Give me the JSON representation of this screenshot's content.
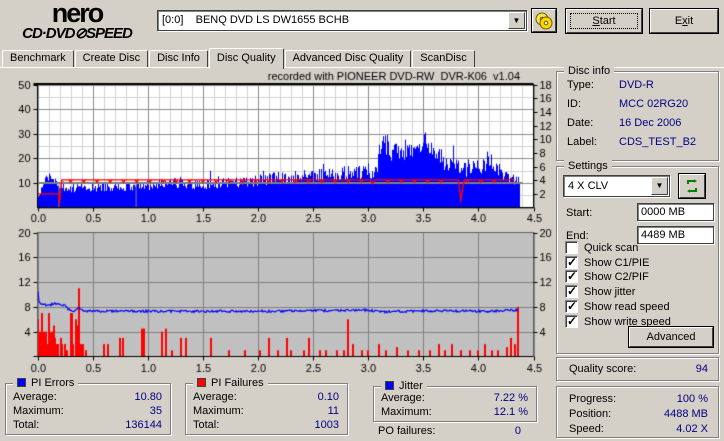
{
  "window": {
    "logo_line1": "nero",
    "logo_line2": "CD·DVD⊘SPEED",
    "drive": "[0:0]    BENQ DVD LS DW1655 BCHB",
    "start_label": "Start",
    "exit_label": "Exit"
  },
  "tabs": [
    {
      "label": "Benchmark",
      "active": false
    },
    {
      "label": "Create Disc",
      "active": false
    },
    {
      "label": "Disc Info",
      "active": false
    },
    {
      "label": "Disc Quality",
      "active": true
    },
    {
      "label": "Advanced Disc Quality",
      "active": false
    },
    {
      "label": "ScanDisc",
      "active": false
    }
  ],
  "disc_info": {
    "title": "Disc info",
    "rows": [
      {
        "label": "Type:",
        "value": "DVD-R"
      },
      {
        "label": "ID:",
        "value": "MCC 02RG20"
      },
      {
        "label": "Date:",
        "value": "16 Dec 2006"
      },
      {
        "label": "Label:",
        "value": "CDS_TEST_B2"
      }
    ]
  },
  "settings": {
    "title": "Settings",
    "speed_selected": "4 X CLV",
    "start_label": "Start:",
    "start_value": "0000 MB",
    "end_label": "End:",
    "end_value": "4489 MB",
    "checkboxes": [
      {
        "label": "Quick scan",
        "checked": false
      },
      {
        "label": "Show C1/PIE",
        "checked": true
      },
      {
        "label": "Show C2/PIF",
        "checked": true
      },
      {
        "label": "Show jitter",
        "checked": true
      },
      {
        "label": "Show read speed",
        "checked": true
      },
      {
        "label": "Show write speed",
        "checked": true
      }
    ],
    "advanced_label": "Advanced"
  },
  "quality": {
    "label": "Quality score:",
    "value": "94"
  },
  "progress_panel": {
    "rows": [
      {
        "label": "Progress:",
        "value": "100 %"
      },
      {
        "label": "Position:",
        "value": "4488 MB"
      },
      {
        "label": "Speed:",
        "value": "4.02 X"
      }
    ]
  },
  "stats": {
    "pi_errors": {
      "title": "PI Errors",
      "color": "#0000ff",
      "rows": [
        {
          "label": "Average:",
          "value": "10.80"
        },
        {
          "label": "Maximum:",
          "value": "35"
        },
        {
          "label": "Total:",
          "value": "136144"
        }
      ]
    },
    "pi_failures": {
      "title": "PI Failures",
      "color": "#ff0000",
      "rows": [
        {
          "label": "Average:",
          "value": "0.10"
        },
        {
          "label": "Maximum:",
          "value": "11"
        },
        {
          "label": "Total:",
          "value": "1003"
        }
      ]
    },
    "jitter": {
      "title": "Jitter",
      "color": "#0000ff",
      "rows": [
        {
          "label": "Average:",
          "value": "7.22 %"
        },
        {
          "label": "Maximum:",
          "value": "12.1 %"
        }
      ]
    },
    "po_failures": {
      "label": "PO failures:",
      "value": "0"
    }
  },
  "chart_data": [
    {
      "type": "area",
      "title": "recorded with PIONEER DVD-RW  DVR-K06  v1.04",
      "bg": "#ffffff",
      "x_range": [
        0,
        4.5
      ],
      "x_tick_step": 0.5,
      "left_axis": {
        "range": [
          0,
          50
        ],
        "tick_step": 10
      },
      "right_axis": {
        "range": [
          0,
          18
        ],
        "tick_step": 2
      },
      "grid": {
        "minor_x": 0.1,
        "minor_y": 5,
        "major_x": 0.5,
        "major_y": 10
      },
      "pi_errors": {
        "name": "PI errors",
        "color": "#0000ff",
        "axis": "left",
        "end_x": 4.37,
        "seed": 7,
        "profile": [
          [
            0,
            5
          ],
          [
            0.03,
            7
          ],
          [
            0.08,
            12
          ],
          [
            0.12,
            13
          ],
          [
            0.15,
            11
          ],
          [
            0.18,
            9
          ],
          [
            0.22,
            8
          ],
          [
            0.3,
            7.5
          ],
          [
            0.5,
            8
          ],
          [
            0.7,
            8.5
          ],
          [
            0.9,
            8.5
          ],
          [
            1.0,
            9
          ],
          [
            1.2,
            10
          ],
          [
            1.4,
            9
          ],
          [
            1.6,
            10
          ],
          [
            1.8,
            10
          ],
          [
            2.0,
            11
          ],
          [
            2.2,
            12
          ],
          [
            2.4,
            12.5
          ],
          [
            2.6,
            13
          ],
          [
            2.8,
            14
          ],
          [
            3.0,
            14
          ],
          [
            3.05,
            15
          ],
          [
            3.08,
            18
          ],
          [
            3.1,
            26
          ],
          [
            3.15,
            27
          ],
          [
            3.2,
            24
          ],
          [
            3.3,
            23
          ],
          [
            3.4,
            23
          ],
          [
            3.5,
            26
          ],
          [
            3.55,
            27
          ],
          [
            3.6,
            22
          ],
          [
            3.7,
            18
          ],
          [
            3.8,
            16
          ],
          [
            3.9,
            16
          ],
          [
            4.0,
            17
          ],
          [
            4.1,
            18
          ],
          [
            4.15,
            16
          ],
          [
            4.2,
            15
          ],
          [
            4.3,
            12
          ],
          [
            4.33,
            11
          ],
          [
            4.37,
            9
          ]
        ],
        "noise_profile": [
          [
            0,
            1.5
          ],
          [
            1.0,
            2
          ],
          [
            2.0,
            2.5
          ],
          [
            3.0,
            3
          ],
          [
            3.08,
            4
          ],
          [
            3.1,
            5
          ],
          [
            3.6,
            5
          ],
          [
            3.65,
            3.5
          ],
          [
            4.2,
            3.5
          ],
          [
            4.37,
            2
          ]
        ],
        "spike_chance": 0.1,
        "max": 35.5
      },
      "read_speed": {
        "name": "read speed",
        "color": "#808080",
        "axis": "right",
        "value": 3.6,
        "x_from": 0,
        "x_to": 4.4,
        "drops": [
          0.19,
          0.89
        ]
      },
      "write_speed": {
        "name": "write speed",
        "color": "#ff0000",
        "axis": "right",
        "points": [
          [
            0,
            2
          ],
          [
            0.19,
            2
          ],
          [
            0.2,
            0.7
          ],
          [
            0.22,
            4.05
          ],
          [
            3.02,
            4.05
          ],
          [
            3.04,
            3.5
          ],
          [
            3.06,
            4.05
          ],
          [
            3.82,
            4.05
          ],
          [
            3.84,
            1.1
          ],
          [
            3.87,
            4.05
          ],
          [
            4.33,
            4.05
          ]
        ],
        "sawtooth": {
          "from": 0.3,
          "to": 4.25,
          "interval": 0.12,
          "depth": 0.35,
          "base": 4.05
        }
      }
    },
    {
      "type": "bars+line",
      "bg": "#c0c0c0",
      "x_range": [
        0,
        4.5
      ],
      "x_tick_step": 0.5,
      "left_axis": {
        "range": [
          0,
          20
        ],
        "tick_step": 4
      },
      "right_axis": {
        "range": [
          0,
          20
        ],
        "tick_step": 4
      },
      "grid": {
        "major_x": 0.5,
        "major_y": 4
      },
      "pi_failures": {
        "name": "PI failures",
        "color": "#ff0000",
        "bars": [
          [
            0.005,
            6
          ],
          [
            0.015,
            4
          ],
          [
            0.025,
            3
          ],
          [
            0.03,
            4
          ],
          [
            0.045,
            7
          ],
          [
            0.055,
            4
          ],
          [
            0.065,
            3
          ],
          [
            0.075,
            4
          ],
          [
            0.09,
            2
          ],
          [
            0.1,
            7
          ],
          [
            0.11,
            4
          ],
          [
            0.12,
            3
          ],
          [
            0.135,
            4
          ],
          [
            0.15,
            5
          ],
          [
            0.16,
            3
          ],
          [
            0.175,
            2
          ],
          [
            0.19,
            2
          ],
          [
            0.21,
            3
          ],
          [
            0.225,
            2
          ],
          [
            0.25,
            2
          ],
          [
            0.27,
            1
          ],
          [
            0.3,
            7
          ],
          [
            0.31,
            7
          ],
          [
            0.325,
            2
          ],
          [
            0.35,
            6
          ],
          [
            0.36,
            5
          ],
          [
            0.38,
            11
          ],
          [
            0.395,
            2
          ],
          [
            0.41,
            2
          ],
          [
            0.44,
            1
          ],
          [
            0.6,
            2
          ],
          [
            0.64,
            2
          ],
          [
            0.75,
            3
          ],
          [
            0.78,
            3
          ],
          [
            0.95,
            4.5
          ],
          [
            0.97,
            4.5
          ],
          [
            1.13,
            4
          ],
          [
            1.17,
            4.5
          ],
          [
            1.22,
            1
          ],
          [
            1.3,
            3
          ],
          [
            1.35,
            3
          ],
          [
            1.57,
            3
          ],
          [
            1.74,
            1
          ],
          [
            1.88,
            1
          ],
          [
            2.02,
            1
          ],
          [
            2.1,
            3
          ],
          [
            2.18,
            1
          ],
          [
            2.26,
            3
          ],
          [
            2.3,
            1
          ],
          [
            2.42,
            1
          ],
          [
            2.46,
            3
          ],
          [
            2.56,
            1
          ],
          [
            2.62,
            1
          ],
          [
            2.72,
            1
          ],
          [
            2.78,
            1
          ],
          [
            2.82,
            6
          ],
          [
            2.86,
            2
          ],
          [
            2.94,
            1
          ],
          [
            3.0,
            1
          ],
          [
            3.1,
            2
          ],
          [
            3.16,
            1
          ],
          [
            3.26,
            1.5
          ],
          [
            3.36,
            1
          ],
          [
            3.46,
            1
          ],
          [
            3.56,
            1
          ],
          [
            3.64,
            2
          ],
          [
            3.7,
            1
          ],
          [
            3.76,
            2
          ],
          [
            3.84,
            1
          ],
          [
            3.92,
            1
          ],
          [
            4.0,
            1
          ],
          [
            4.06,
            2
          ],
          [
            4.12,
            1
          ],
          [
            4.18,
            1
          ],
          [
            4.26,
            1.5
          ],
          [
            4.3,
            3
          ],
          [
            4.33,
            2
          ],
          [
            4.36,
            8
          ]
        ]
      },
      "jitter": {
        "name": "jitter",
        "color": "#0000ff",
        "end_x": 4.36,
        "seed": 3,
        "noise": 0.18,
        "profile": [
          [
            0,
            12
          ],
          [
            0.01,
            9
          ],
          [
            0.03,
            8.4
          ],
          [
            0.1,
            8.3
          ],
          [
            0.15,
            8.5
          ],
          [
            0.2,
            8.4
          ],
          [
            0.25,
            8.2
          ],
          [
            0.28,
            7.6
          ],
          [
            0.32,
            7.3
          ],
          [
            0.38,
            7.8
          ],
          [
            0.42,
            7.4
          ],
          [
            0.5,
            7.3
          ],
          [
            0.9,
            7.3
          ],
          [
            1.3,
            7.3
          ],
          [
            1.7,
            7.3
          ],
          [
            2.1,
            7.3
          ],
          [
            2.5,
            7.4
          ],
          [
            2.9,
            7.45
          ],
          [
            3.0,
            7.5
          ],
          [
            3.1,
            7.2
          ],
          [
            3.5,
            7.35
          ],
          [
            3.9,
            7.35
          ],
          [
            4.1,
            7.3
          ],
          [
            4.25,
            7.45
          ],
          [
            4.36,
            7.5
          ]
        ]
      }
    }
  ]
}
